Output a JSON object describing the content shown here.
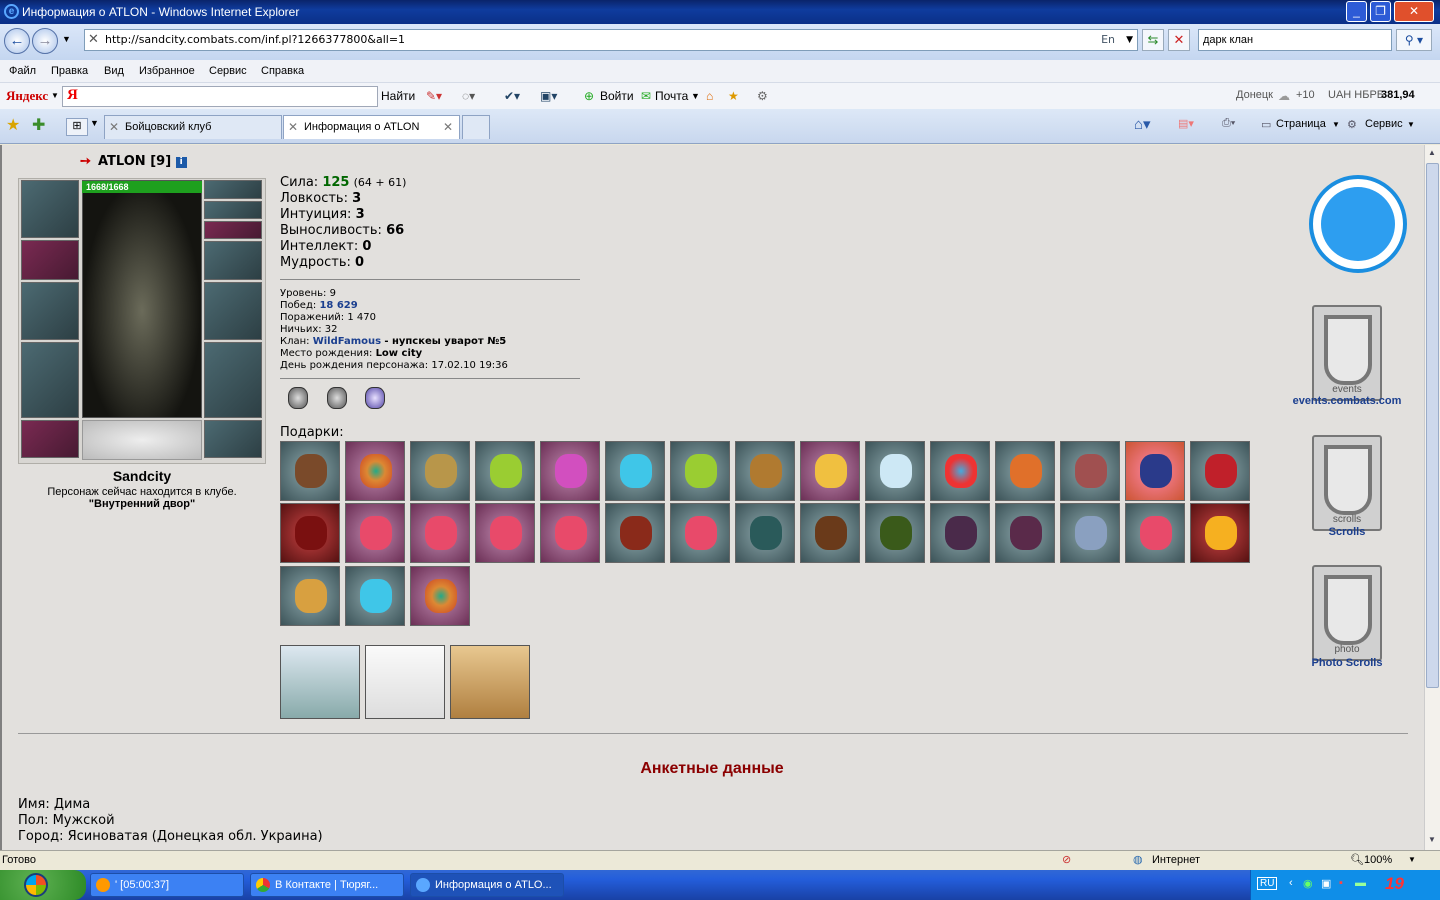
{
  "window": {
    "title": "Информация о ATLON - Windows Internet Explorer"
  },
  "nav": {
    "url": "http://sandcity.combats.com/inf.pl?1266377800&all=1",
    "search_value": "дарк клан",
    "lang_indicator": "En"
  },
  "menu": [
    "Файл",
    "Правка",
    "Вид",
    "Избранное",
    "Сервис",
    "Справка"
  ],
  "yandex": {
    "logo": "Яндекс",
    "input_logo": "Я",
    "find": "Найти",
    "login": "Войти",
    "mail": "Почта",
    "city": "Донецк",
    "temp": "+10",
    "rate_label": "UAH НБРБ",
    "rate_value": "381,94"
  },
  "tabs": [
    {
      "label": "Бойцовский клуб"
    },
    {
      "label": "Информация о ATLON"
    }
  ],
  "command_bar": {
    "page": "Страница",
    "service": "Сервис"
  },
  "character": {
    "name": "ATLON",
    "level": "[9]",
    "hp": "1668/1668",
    "city": "Sandcity",
    "location_text": "Персонаж сейчас находится в клубе.",
    "location_place": "\"Внутренний двор\""
  },
  "stats": [
    {
      "label": "Сила:",
      "value": "125",
      "extra": "(64 + 61)"
    },
    {
      "label": "Ловкость:",
      "value": "3"
    },
    {
      "label": "Интуиция:",
      "value": "3"
    },
    {
      "label": "Выносливость:",
      "value": "66"
    },
    {
      "label": "Интеллект:",
      "value": "0"
    },
    {
      "label": "Мудрость:",
      "value": "0"
    }
  ],
  "info": {
    "level_label": "Уровень:",
    "level": "9",
    "wins_label": "Побед:",
    "wins": "18 629",
    "losses_label": "Поражений:",
    "losses": "1 470",
    "draws_label": "Ничьих:",
    "draws": "32",
    "clan_label": "Клан:",
    "clan": "WildFamous",
    "clan_title": "- нупскеы уварот №5",
    "birthplace_label": "Место рождения:",
    "birthplace": "Low city",
    "birthday_label": "День рождения персонажа:",
    "birthday": "17.02.10 19:36"
  },
  "gifts_label": "Подарки:",
  "side": {
    "events": "events.combats.com",
    "scrolls": "Scrolls",
    "photo": "Photo Scrolls",
    "events_plate": "events",
    "scrolls_plate": "scrolls",
    "photo_plate": "photo"
  },
  "profile": {
    "heading": "Анкетные данные",
    "name_label": "Имя:",
    "name": "Дима",
    "gender_label": "Пол:",
    "gender": "Мужской",
    "city_label": "Город:",
    "city": "Ясиноватая (Донецкая обл. Украина)"
  },
  "status": {
    "text": "Готово",
    "zone": "Интернет",
    "zoom": "100%"
  },
  "taskbar": {
    "items": [
      {
        "label": "' [05:00:37]"
      },
      {
        "label": "В Контакте | Тюряг..."
      },
      {
        "label": "Информация о ATLO..."
      }
    ],
    "lang": "RU",
    "time": "19"
  }
}
